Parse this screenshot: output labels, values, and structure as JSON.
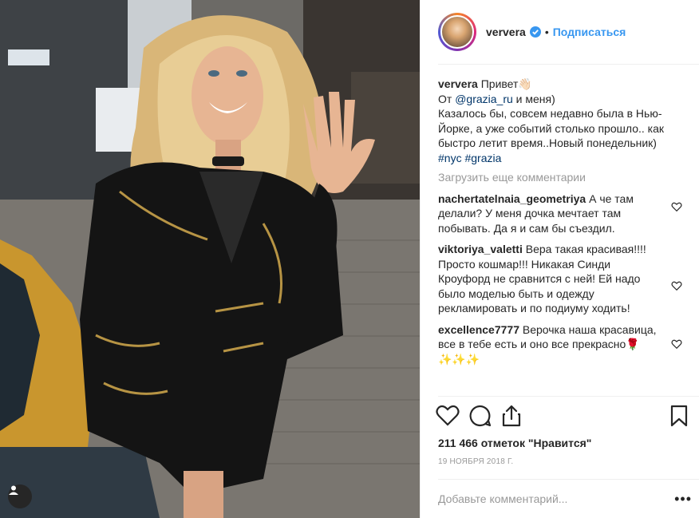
{
  "post": {
    "username": "ververa",
    "follow_label": "Подписаться",
    "separator": "•",
    "caption": {
      "author": "ververa",
      "text_1": "Привет👋🏻",
      "text_2_pre": "От ",
      "mention": "@grazia_ru",
      "text_2_post": " и меня)",
      "text_3": "Казалось бы, совсем недавно была в Нью-Йорке, а уже событий столько прошло.. как быстро летит время..Новый понедельник) ",
      "hashtag_1": "#nyc",
      "hashtag_2": "#grazia"
    },
    "load_more_label": "Загрузить еще комментарии",
    "comments": [
      {
        "author": "nachertatelnaia_geometriya",
        "text": "А че там делали? У меня дочка мечтает там побывать. Да я и сам бы съездил."
      },
      {
        "author": "viktoriya_valetti",
        "text": "Вера такая красивая!!!! Просто кошмар!!! Никакая Синди Кроуфорд не сравнится с ней! Ей надо было моделью быть и одежду рекламировать и по подиуму ходить!"
      },
      {
        "author": "excellence7777",
        "text": "Верочка наша красавица, все в тебе есть и оно все прекрасно🌹✨✨✨"
      }
    ],
    "likes_label": "211 466 отметок \"Нравится\"",
    "date_label": "19 НОЯБРЯ 2018 Г.",
    "add_comment_placeholder": "Добавьте комментарий...",
    "more_label": "•••",
    "icons": {
      "verified": "verified-badge-icon",
      "like": "heart-icon",
      "comment": "comment-bubble-icon",
      "share": "share-icon",
      "save": "bookmark-icon",
      "tagged": "user-tag-icon"
    },
    "colors": {
      "link": "#003569",
      "follow": "#3897f0",
      "muted": "#999999"
    }
  }
}
